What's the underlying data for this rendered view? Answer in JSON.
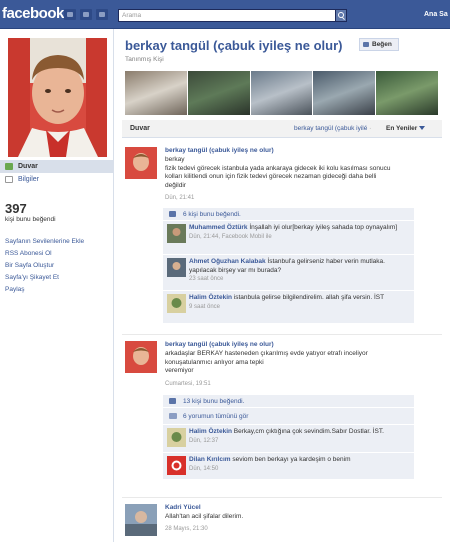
{
  "topbar": {
    "logo": "facebook",
    "search_placeholder": "Arama",
    "user_name": "Ana Sa"
  },
  "sidebar": {
    "items": [
      {
        "label": "Duvar",
        "active": true,
        "icon": "wall-icon"
      },
      {
        "label": "Bilgiler",
        "active": false,
        "icon": "info-icon"
      }
    ],
    "likes_count": "397",
    "likes_label": "kişi bunu beğendi",
    "links": [
      "Sayfanın Sevilenlerine Ekle",
      "RSS Abonesi Ol",
      "Bir Sayfa Oluştur",
      "Sayfa'yı Şikayet Et",
      "Paylaş"
    ]
  },
  "page": {
    "title": "berkay tangül (çabuk iyileş ne olur)",
    "like_button": "Beğen",
    "subtitle": "Tanınmış Kişi"
  },
  "wall_bar": {
    "tab": "Duvar",
    "filter": "berkay tangül (çabuk iyilé",
    "separator": "·",
    "sort": "En Yeniler"
  },
  "stories": [
    {
      "author": "berkay tangül (çabuk iyileş ne olur)",
      "text_lines": [
        "berkay",
        "fizik tedevi görecek istanbula yada ankaraya gidecek iki kolu kasılması sonucu",
        "kolları kilitlendi onun için fizik tedevi görecek nezaman gideceği daha belli",
        "değildir"
      ],
      "time": "Dün, 21:41",
      "likes": "6 kişi bunu beğendi.",
      "comments": [
        {
          "name": "Muhammed Öztürk",
          "text": "İnşallah iyi olur[berkay iyileş sahada top oynayalım]",
          "time": "Dün, 21:44, Facebook Mobil ile"
        },
        {
          "name": "Ahmet Oğuzhan Kalabak",
          "text": "İstanbul'a gelirseniz haber verin mutlaka. yapılacak birşey var mı burada?",
          "time": "23 saat önce"
        },
        {
          "name": "Halim Öztekin",
          "text": "istanbula gelirse bilgilendirelim. allah şifa versin. İST",
          "time": "9 saat önce"
        }
      ]
    },
    {
      "author": "berkay tangül (çabuk iyileş ne olur)",
      "text_lines": [
        "arkadaşlar BERKAY hasteneden çıkarılmış evde yatıyor etrafı inceliyor",
        "konuşatulanmıcı anlıyor ama tepki",
        "veremiyor"
      ],
      "time": "Cumartesi, 19:51",
      "likes": "13 kişi bunu beğendi.",
      "view_all": "6 yorumun tümünü gör",
      "comments": [
        {
          "name": "Halim Öztekin",
          "text": "Berkay,cm çıktığına çok sevindim.Sabır Dostlar. İST.",
          "time": "Dün, 12:37"
        },
        {
          "name": "Dilan Kırılcım",
          "text": "seviom ben berkayı ya kardeşim o benim",
          "time": "Dün, 14:50"
        }
      ]
    },
    {
      "author": "Kadri Yücel",
      "text_lines": [
        "Allah'tan acil şifalar dilerim."
      ],
      "time": "28 Mayıs, 21:30"
    }
  ],
  "colors": {
    "brand": "#3b5998",
    "feedback_bg": "#eceff5",
    "active_nav": "#d8dfea"
  }
}
